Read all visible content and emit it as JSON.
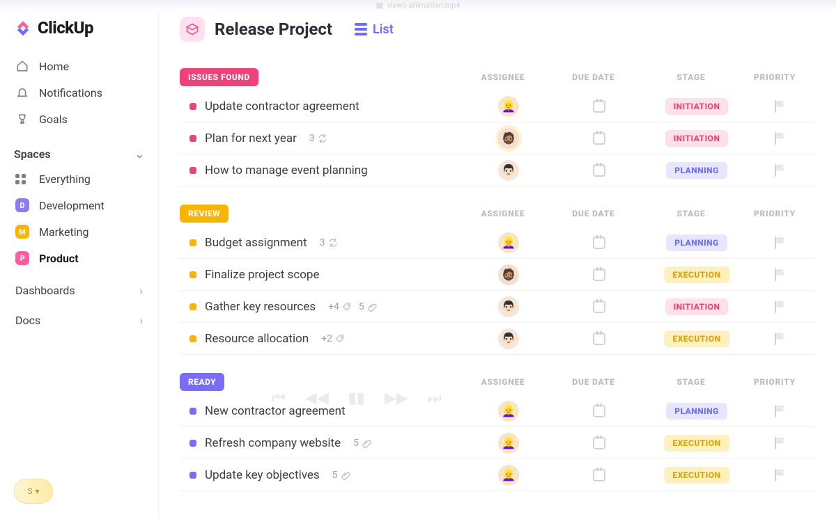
{
  "window": {
    "filename": "views-animation.mp4"
  },
  "brand": {
    "name": "ClickUp"
  },
  "nav": {
    "home": "Home",
    "notifications": "Notifications",
    "goals": "Goals"
  },
  "spaces": {
    "heading": "Spaces",
    "everything": "Everything",
    "items": [
      {
        "letter": "D",
        "label": "Development",
        "color": "#8b7bf7"
      },
      {
        "letter": "M",
        "label": "Marketing",
        "color": "#f7b500"
      },
      {
        "letter": "P",
        "label": "Product",
        "color": "#ff5fa2"
      }
    ]
  },
  "sideLinks": {
    "dashboards": "Dashboards",
    "docs": "Docs"
  },
  "footer": {
    "pill_letter": "S"
  },
  "breadcrumb": {
    "title": "Release Project",
    "view": "List"
  },
  "columns": {
    "assignee": "ASSIGNEE",
    "due": "DUE DATE",
    "stage": "STAGE",
    "priority": "PRIORITY"
  },
  "stages": {
    "initiation": {
      "label": "INITIATION",
      "bg": "#ffe1ea",
      "fg": "#ee427a"
    },
    "planning": {
      "label": "PLANNING",
      "bg": "#e6e6ff",
      "fg": "#6f6cf5"
    },
    "execution": {
      "label": "EXECUTION",
      "bg": "#fff1bf",
      "fg": "#d9a400"
    }
  },
  "avatars": {
    "blonde": {
      "bg": "#f7e5c8",
      "emoji": "👱‍♀️"
    },
    "man1": {
      "bg": "#f2e0cf",
      "emoji": "🧔🏽"
    },
    "man2": {
      "bg": "#f5e6da",
      "emoji": "👨🏻"
    }
  },
  "groups": [
    {
      "status": "ISSUES FOUND",
      "status_color": "#f0427a",
      "dot": "#f0427a",
      "tasks": [
        {
          "title": "Update contractor agreement",
          "avatar": "blonde",
          "stage": "initiation"
        },
        {
          "title": "Plan for next year",
          "avatar": "man1",
          "avatar_ring": true,
          "stage": "initiation",
          "meta": [
            {
              "kind": "recur",
              "text": "3"
            }
          ]
        },
        {
          "title": "How to manage event planning",
          "avatar": "man2",
          "stage": "planning"
        }
      ]
    },
    {
      "status": "REVIEW",
      "status_color": "#f7b500",
      "dot": "#f7b500",
      "tasks": [
        {
          "title": "Budget assignment",
          "avatar": "blonde",
          "stage": "planning",
          "meta": [
            {
              "kind": "recur",
              "text": "3"
            }
          ]
        },
        {
          "title": "Finalize project scope",
          "avatar": "man1",
          "stage": "execution"
        },
        {
          "title": "Gather key resources",
          "avatar": "man2",
          "stage": "initiation",
          "meta": [
            {
              "kind": "tag",
              "text": "+4"
            },
            {
              "kind": "attach",
              "text": "5"
            }
          ]
        },
        {
          "title": "Resource allocation",
          "avatar": "man2",
          "stage": "execution",
          "meta": [
            {
              "kind": "tag",
              "text": "+2"
            }
          ]
        }
      ]
    },
    {
      "status": "READY",
      "status_color": "#7b6cf6",
      "dot": "#7b6cf6",
      "tasks": [
        {
          "title": "New contractor agreement",
          "avatar": "blonde",
          "stage": "planning"
        },
        {
          "title": "Refresh company website",
          "avatar": "blonde",
          "stage": "execution",
          "meta": [
            {
              "kind": "attach",
              "text": "5"
            }
          ]
        },
        {
          "title": "Update key objectives",
          "avatar": "blonde",
          "stage": "execution",
          "meta": [
            {
              "kind": "attach",
              "text": "5"
            }
          ]
        }
      ]
    }
  ]
}
